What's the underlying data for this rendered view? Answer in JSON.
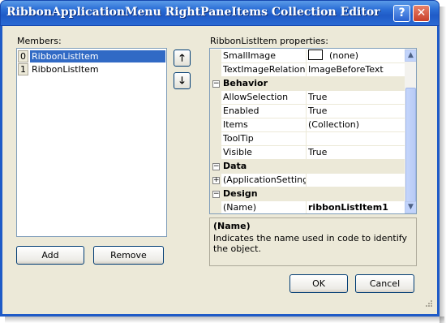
{
  "window": {
    "title": "RibbonApplicationMenu RightPaneItems Collection Editor",
    "help_label": "?",
    "close_label": "✕"
  },
  "members": {
    "label": "Members:",
    "items": [
      {
        "index": "0",
        "name": "RibbonListItem"
      },
      {
        "index": "1",
        "name": "RibbonListItem"
      }
    ],
    "selected_index": 0,
    "move_up_icon": "up-arrow-icon",
    "move_down_icon": "down-arrow-icon",
    "add_label": "Add",
    "remove_label": "Remove"
  },
  "properties": {
    "label": "RibbonListItem properties:",
    "rows": [
      {
        "kind": "prop",
        "name": "SmallImage",
        "value": "(none)",
        "swatch": true
      },
      {
        "kind": "prop",
        "name": "TextImageRelation",
        "value": "ImageBeforeText"
      },
      {
        "kind": "cat",
        "name": "Behavior",
        "toggle": "−"
      },
      {
        "kind": "prop",
        "name": "AllowSelection",
        "value": "True"
      },
      {
        "kind": "prop",
        "name": "Enabled",
        "value": "True"
      },
      {
        "kind": "prop",
        "name": "Items",
        "value": "(Collection)"
      },
      {
        "kind": "prop",
        "name": "ToolTip",
        "value": ""
      },
      {
        "kind": "prop",
        "name": "Visible",
        "value": "True"
      },
      {
        "kind": "cat",
        "name": "Data",
        "toggle": "−"
      },
      {
        "kind": "prop",
        "name": "(ApplicationSettings)",
        "value": "",
        "toggle": "+"
      },
      {
        "kind": "cat",
        "name": "Design",
        "toggle": "−"
      },
      {
        "kind": "prop",
        "name": "(Name)",
        "value": "ribbonListItem1",
        "bold": true
      }
    ],
    "description": {
      "title": "(Name)",
      "text": "Indicates the name used in code to identify the object."
    }
  },
  "footer": {
    "ok_label": "OK",
    "cancel_label": "Cancel"
  },
  "colors": {
    "title_bar": "#2c6fd6",
    "selection": "#316ac5",
    "dialog_bg": "#ece9d8"
  }
}
